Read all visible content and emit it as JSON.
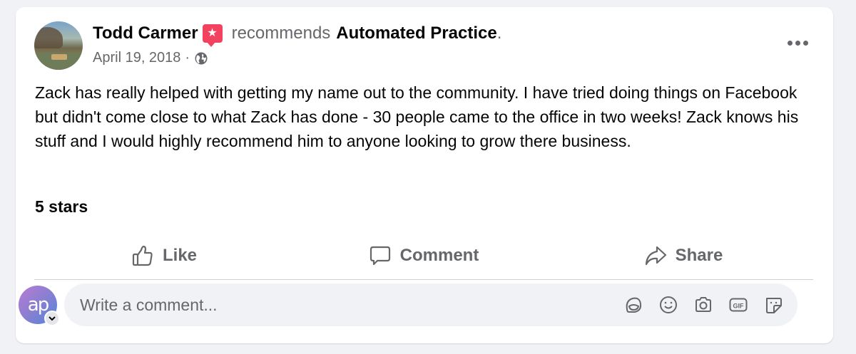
{
  "post": {
    "author": "Todd Carmer",
    "verb": "recommends",
    "page": "Automated Practice",
    "page_suffix": ".",
    "date": "April 19, 2018",
    "date_separator": "·",
    "body": "Zack has really helped with getting my name out to the community. I have tried doing things on Facebook but didn't come close to what Zack has done - 30 people came to the office in two weeks! Zack knows his stuff and I would highly recommend him to anyone looking to grow there business.",
    "rating": "5 stars",
    "rating_value": 5,
    "badge_icon": "recommendation-star-icon",
    "privacy_icon": "globe-icon"
  },
  "actions": {
    "like_label": "Like",
    "comment_label": "Comment",
    "share_label": "Share"
  },
  "composer": {
    "avatar_initials": "ap",
    "placeholder": "Write a comment...",
    "tool_icons": [
      "avatar-sticker-icon",
      "emoji-icon",
      "camera-icon",
      "gif-icon",
      "sticker-icon"
    ]
  },
  "colors": {
    "badge": "#f3425f",
    "secondary_text": "#65676b",
    "primary_text": "#050505",
    "input_bg": "#f0f2f5"
  }
}
